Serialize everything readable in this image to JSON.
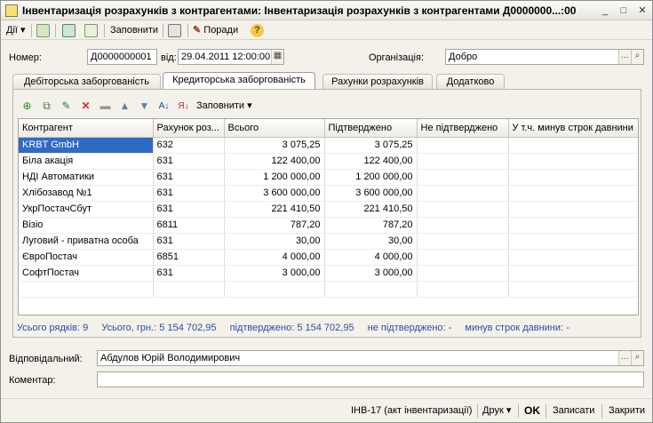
{
  "window": {
    "title": "Інвентаризація розрахунків з контрагентами: Інвентаризація розрахунків з контрагентами Д0000000...:00",
    "controls": [
      "_",
      "□",
      "✕"
    ]
  },
  "toolbar": {
    "actions_label": "Дії",
    "fill_label": "Заповнити",
    "hints_label": "Поради"
  },
  "header": {
    "number_label": "Номер:",
    "number_value": "Д0000000001",
    "date_label": "від:",
    "date_value": "29.04.2011 12:00:00",
    "org_label": "Організація:",
    "org_value": "Добро"
  },
  "tabs": [
    {
      "label": "Дебіторська заборгованість"
    },
    {
      "label": "Кредиторська заборгованість"
    },
    {
      "label": "Рахунки розрахунків"
    },
    {
      "label": "Додатково"
    }
  ],
  "grid_toolbar": {
    "fill_label": "Заповнити"
  },
  "table": {
    "columns": [
      "Контрагент",
      "Рахунок роз...",
      "Всього",
      "Підтверджено",
      "Не підтверджено",
      "У т.ч. минув строк давнини"
    ],
    "rows": [
      [
        "KRBT GmbH",
        "632",
        "3 075,25",
        "3 075,25",
        "",
        ""
      ],
      [
        "Біла акація",
        "631",
        "122 400,00",
        "122 400,00",
        "",
        ""
      ],
      [
        "НДІ Автоматики",
        "631",
        "1 200 000,00",
        "1 200 000,00",
        "",
        ""
      ],
      [
        "Хлібозавод №1",
        "631",
        "3 600 000,00",
        "3 600 000,00",
        "",
        ""
      ],
      [
        "УкрПостачСбут",
        "631",
        "221 410,50",
        "221 410,50",
        "",
        ""
      ],
      [
        "Візіо",
        "6811",
        "787,20",
        "787,20",
        "",
        ""
      ],
      [
        "Луговий - приватна особа",
        "631",
        "30,00",
        "30,00",
        "",
        ""
      ],
      [
        "ЄвроПостач",
        "6851",
        "4 000,00",
        "4 000,00",
        "",
        ""
      ],
      [
        "СофтПостач",
        "631",
        "3 000,00",
        "3 000,00",
        "",
        ""
      ]
    ]
  },
  "summary": {
    "rows": "Усього рядків: 9",
    "total": "Усього, грн.: 5 154 702,95",
    "confirmed": "підтверджено: 5 154 702,95",
    "unconfirmed": "не підтверджено: -",
    "expired": "минув строк давнини: -"
  },
  "footer": {
    "responsible_label": "Відповідальний:",
    "responsible_value": "Абдулов Юрій Володимирович",
    "comment_label": "Коментар:",
    "comment_value": ""
  },
  "status": {
    "print_form": "ІНВ-17 (акт інвентаризації)",
    "print_label": "Друк",
    "ok_label": "OK",
    "save_label": "Записати",
    "close_label": "Закрити"
  },
  "colors": {
    "selection": "#316ac5",
    "summary_text": "#2b4fa8"
  }
}
